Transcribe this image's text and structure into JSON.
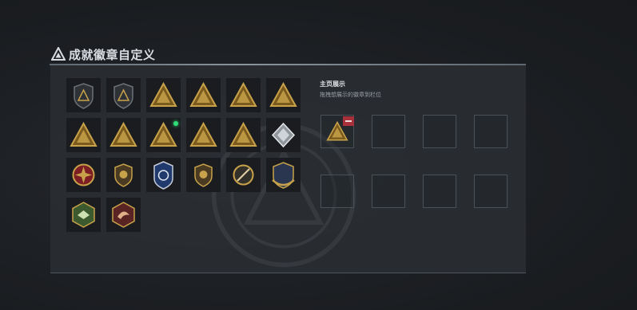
{
  "header": {
    "title": "成就徽章自定义"
  },
  "display_panel": {
    "title": "主页展示",
    "subtitle": "拖拽想展示的徽章到栏位"
  },
  "badges": [
    {
      "icon": "shield-emblem-icon",
      "style": "shield"
    },
    {
      "icon": "helicopter-emblem-icon",
      "style": "shield"
    },
    {
      "icon": "supply-crate-triangle-icon",
      "style": "tri"
    },
    {
      "icon": "vehicle-triangle-icon",
      "style": "tri"
    },
    {
      "icon": "boat-triangle-icon",
      "style": "tri"
    },
    {
      "icon": "cannon-triangle-icon",
      "style": "tri"
    },
    {
      "icon": "number-one-triangle-icon",
      "style": "tri"
    },
    {
      "icon": "container-triangle-icon",
      "style": "tri"
    },
    {
      "icon": "soldier-triangle-icon",
      "style": "tri",
      "new": true
    },
    {
      "icon": "squad-triangle-icon",
      "style": "tri"
    },
    {
      "icon": "crossed-rifles-triangle-icon",
      "style": "tri"
    },
    {
      "icon": "silver-diamond-icon",
      "style": "diamond"
    },
    {
      "icon": "cross-medal-icon",
      "style": "medal"
    },
    {
      "icon": "shield-crest-icon",
      "style": "crest"
    },
    {
      "icon": "police-badge-icon",
      "style": "police"
    },
    {
      "icon": "lion-shield-icon",
      "style": "crest"
    },
    {
      "icon": "sword-ring-icon",
      "style": "ring"
    },
    {
      "icon": "laurel-shield-icon",
      "style": "laurel"
    },
    {
      "icon": "eagle-hexagon-icon",
      "style": "hex-green"
    },
    {
      "icon": "dragon-hexagon-icon",
      "style": "hex-red"
    }
  ],
  "slots": [
    {
      "filled": true,
      "icon": "soldier-triangle-icon"
    },
    {
      "filled": false
    },
    {
      "filled": false
    },
    {
      "filled": false
    },
    {
      "filled": false
    },
    {
      "filled": false
    },
    {
      "filled": false
    },
    {
      "filled": false
    }
  ],
  "colors": {
    "gold": "#c8a24a",
    "gold_dark": "#7a5a1d",
    "remove_button": "#a8303a",
    "new_indicator": "#2fe07a"
  }
}
